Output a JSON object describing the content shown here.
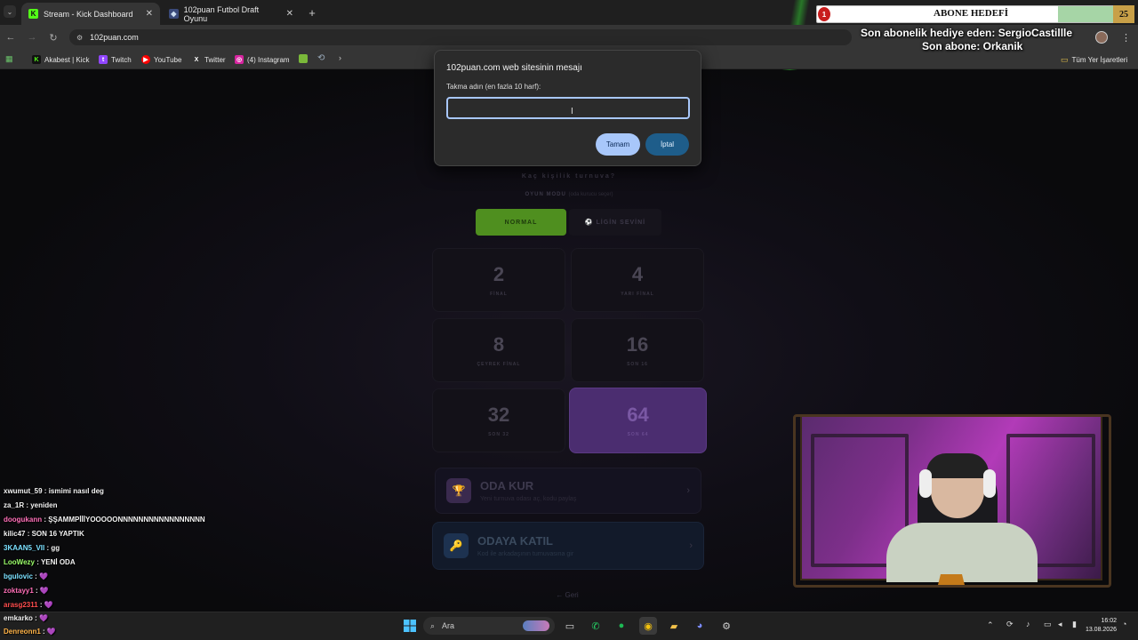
{
  "browser": {
    "tabs": [
      {
        "title": "Stream - Kick Dashboard",
        "favicon": "K"
      },
      {
        "title": "102puan Futbol Draft Oyunu",
        "favicon": "◆"
      }
    ],
    "new_tab_glyph": "+",
    "address": "102puan.com",
    "bookmarks": [
      {
        "label": "Akabest | Kick",
        "icon": "K",
        "color": "#53fc18"
      },
      {
        "label": "Twitch",
        "icon": "t",
        "color": "#9146ff"
      },
      {
        "label": "YouTube",
        "icon": "▶",
        "color": "#ff0000"
      },
      {
        "label": "Twitter",
        "icon": "X",
        "color": "#333333"
      },
      {
        "label": "(4) Instagram",
        "icon": "◎",
        "color": "#d6249f"
      }
    ],
    "all_bookmarks_label": "Tüm Yer İşaretleri"
  },
  "dialog": {
    "title": "102puan.com web sitesinin mesajı",
    "label": "Takma adın (en fazla 10 harf):",
    "input_value": "",
    "ok_label": "Tamam",
    "cancel_label": "İptal"
  },
  "game": {
    "subtitle": "Kaç kişilik turnuva?",
    "mode_label": "OYUN MODU",
    "mode_hint": "(oda kurucu seçer)",
    "modes": {
      "normal": "NORMAL",
      "league": "⚽ LİGİN SEVİNİ"
    },
    "sizes": [
      {
        "num": "2",
        "label": "FİNAL"
      },
      {
        "num": "4",
        "label": "YARI FİNAL"
      },
      {
        "num": "8",
        "label": "ÇEYREK FİNAL"
      },
      {
        "num": "16",
        "label": "SON 16"
      },
      {
        "num": "32",
        "label": "SON 32"
      },
      {
        "num": "64",
        "label": "SON 64"
      }
    ],
    "selected_size": "64",
    "create_room": {
      "title": "ODA KUR",
      "sub": "Yeni turnuva odası aç, kodu paylaş",
      "icon": "🏆"
    },
    "join_room": {
      "title": "ODAYA KATIL",
      "sub": "Kod ile arkadaşının turnuvasına gir",
      "icon": "🔑"
    },
    "back": "← Geri"
  },
  "overlay": {
    "goal_badge": "1",
    "goal_title": "ABONE HEDEFİ",
    "goal_count": "25",
    "gift_line": "Son abonelik hediye eden: SergioCastillle",
    "last_sub_line": "Son abone: Orkanik"
  },
  "chat": [
    {
      "user": "xwumut_59",
      "msg": "ismimi nasıl deg",
      "color": "#f2f2f2"
    },
    {
      "user": "za_1R",
      "msg": "yeniden",
      "color": "#f2f2f2"
    },
    {
      "user": "doogukann",
      "msg": "ŞŞAMMPİİİYOOOOONNNNNNNNNNNNNNNNN",
      "color": "#ff6fb8"
    },
    {
      "user": "kilic47",
      "msg": "SON 16 YAPTIK",
      "color": "#f2f2f2"
    },
    {
      "user": "3KAAN5_VII",
      "msg": "gg",
      "color": "#7be0ff"
    },
    {
      "user": "LooWezy",
      "msg": "YENİ ODA",
      "color": "#9cff6a"
    },
    {
      "user": "bgulovic",
      "msg": "💜",
      "color": "#7be0ff"
    },
    {
      "user": "zoktayy1",
      "msg": "💜",
      "color": "#ff6fb8"
    },
    {
      "user": "arasg2311",
      "msg": "💜",
      "color": "#ff4d4d"
    },
    {
      "user": "emkarko",
      "msg": "💜",
      "color": "#f2f2f2"
    },
    {
      "user": "Denreonn1",
      "msg": "💜",
      "color": "#ffb347"
    }
  ],
  "taskbar": {
    "search_label": "Ara",
    "time": "16:02",
    "date": "13.08.2026"
  }
}
